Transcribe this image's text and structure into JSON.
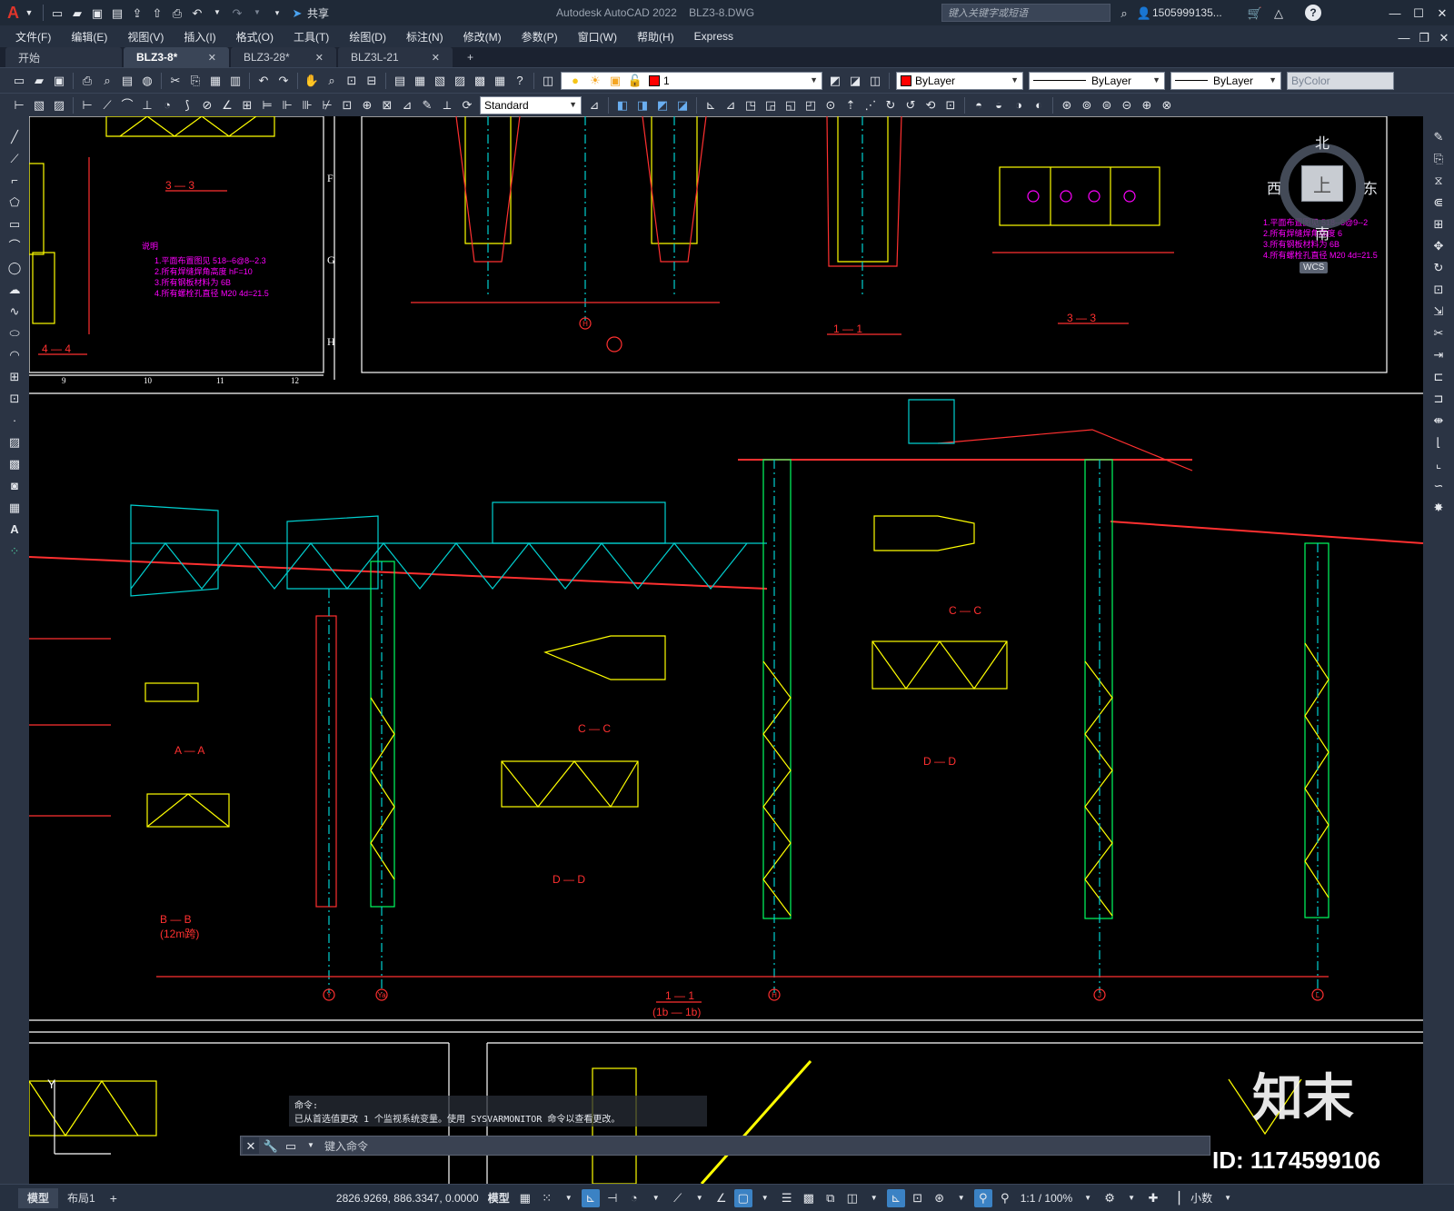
{
  "titlebar": {
    "app_letter": "A",
    "share_label": "共享",
    "title": "Autodesk AutoCAD 2022    BLZ3-8.DWG",
    "search_placeholder": "键入关键字或短语",
    "user": "1505999135...",
    "help": "?"
  },
  "menu": [
    "文件(F)",
    "编辑(E)",
    "视图(V)",
    "插入(I)",
    "格式(O)",
    "工具(T)",
    "绘图(D)",
    "标注(N)",
    "修改(M)",
    "参数(P)",
    "窗口(W)",
    "帮助(H)",
    "Express"
  ],
  "tabs": [
    {
      "label": "开始",
      "close": ""
    },
    {
      "label": "BLZ3-8*",
      "close": "✕"
    },
    {
      "label": "BLZ3-28*",
      "close": "✕"
    },
    {
      "label": "BLZ3L-21",
      "close": "✕"
    }
  ],
  "tab_add": "+",
  "toolbar": {
    "layer_value": "1",
    "color_value": "ByLayer",
    "linetype_value": "ByLayer",
    "lineweight_value": "ByLayer",
    "plotstyle_value": "ByColor",
    "textstyle_value": "Standard"
  },
  "viewcube": {
    "north": "北",
    "south": "南",
    "east": "东",
    "west": "西",
    "top": "上",
    "wcs": "WCS"
  },
  "drawing": {
    "grid_labels": [
      "F",
      "G",
      "H"
    ],
    "axis_bottom": [
      "9",
      "10",
      "11",
      "12"
    ],
    "section_labels": [
      "3 — 3",
      "4 — 4",
      "1 — 1",
      "3 — 3",
      "A — A",
      "B — B",
      "(12m跨)",
      "C — C",
      "D — D",
      "C — C",
      "D — D",
      "1 — 1",
      "(1b — 1b)"
    ],
    "axis_circles": [
      "Y",
      "Ya",
      "H",
      "J",
      "L",
      "H"
    ],
    "notes": [
      "说明",
      "1.平面布置图见  518--6@8--2.3",
      "2.所有焊缝焊角高度 hF=10",
      "3.所有钢板材料为 6B",
      "4.所有螺栓孔直径 M20 4d=21.5"
    ],
    "notes_right": [
      "1.平面布置图见  518--6@9--2",
      "2.所有焊缝焊角高度 6",
      "3.所有钢板材料为 6B",
      "4.所有螺栓孔直径 M20 4d=21.5"
    ],
    "ucs_y": "Y"
  },
  "command": {
    "history_label": "命令:",
    "history_line": "已从首选值更改 1 个监视系统变量。使用 SYSVARMONITOR 命令以查看更改。",
    "input_placeholder": "键入命令"
  },
  "layout_tabs": [
    "模型",
    "布局1"
  ],
  "layout_add": "+",
  "status": {
    "coords": "2826.9269, 886.3347, 0.0000",
    "model": "模型",
    "scale": "1:1 / 100%",
    "units": "小数"
  },
  "watermark": {
    "logo": "知末",
    "id": "ID: 1174599106"
  }
}
